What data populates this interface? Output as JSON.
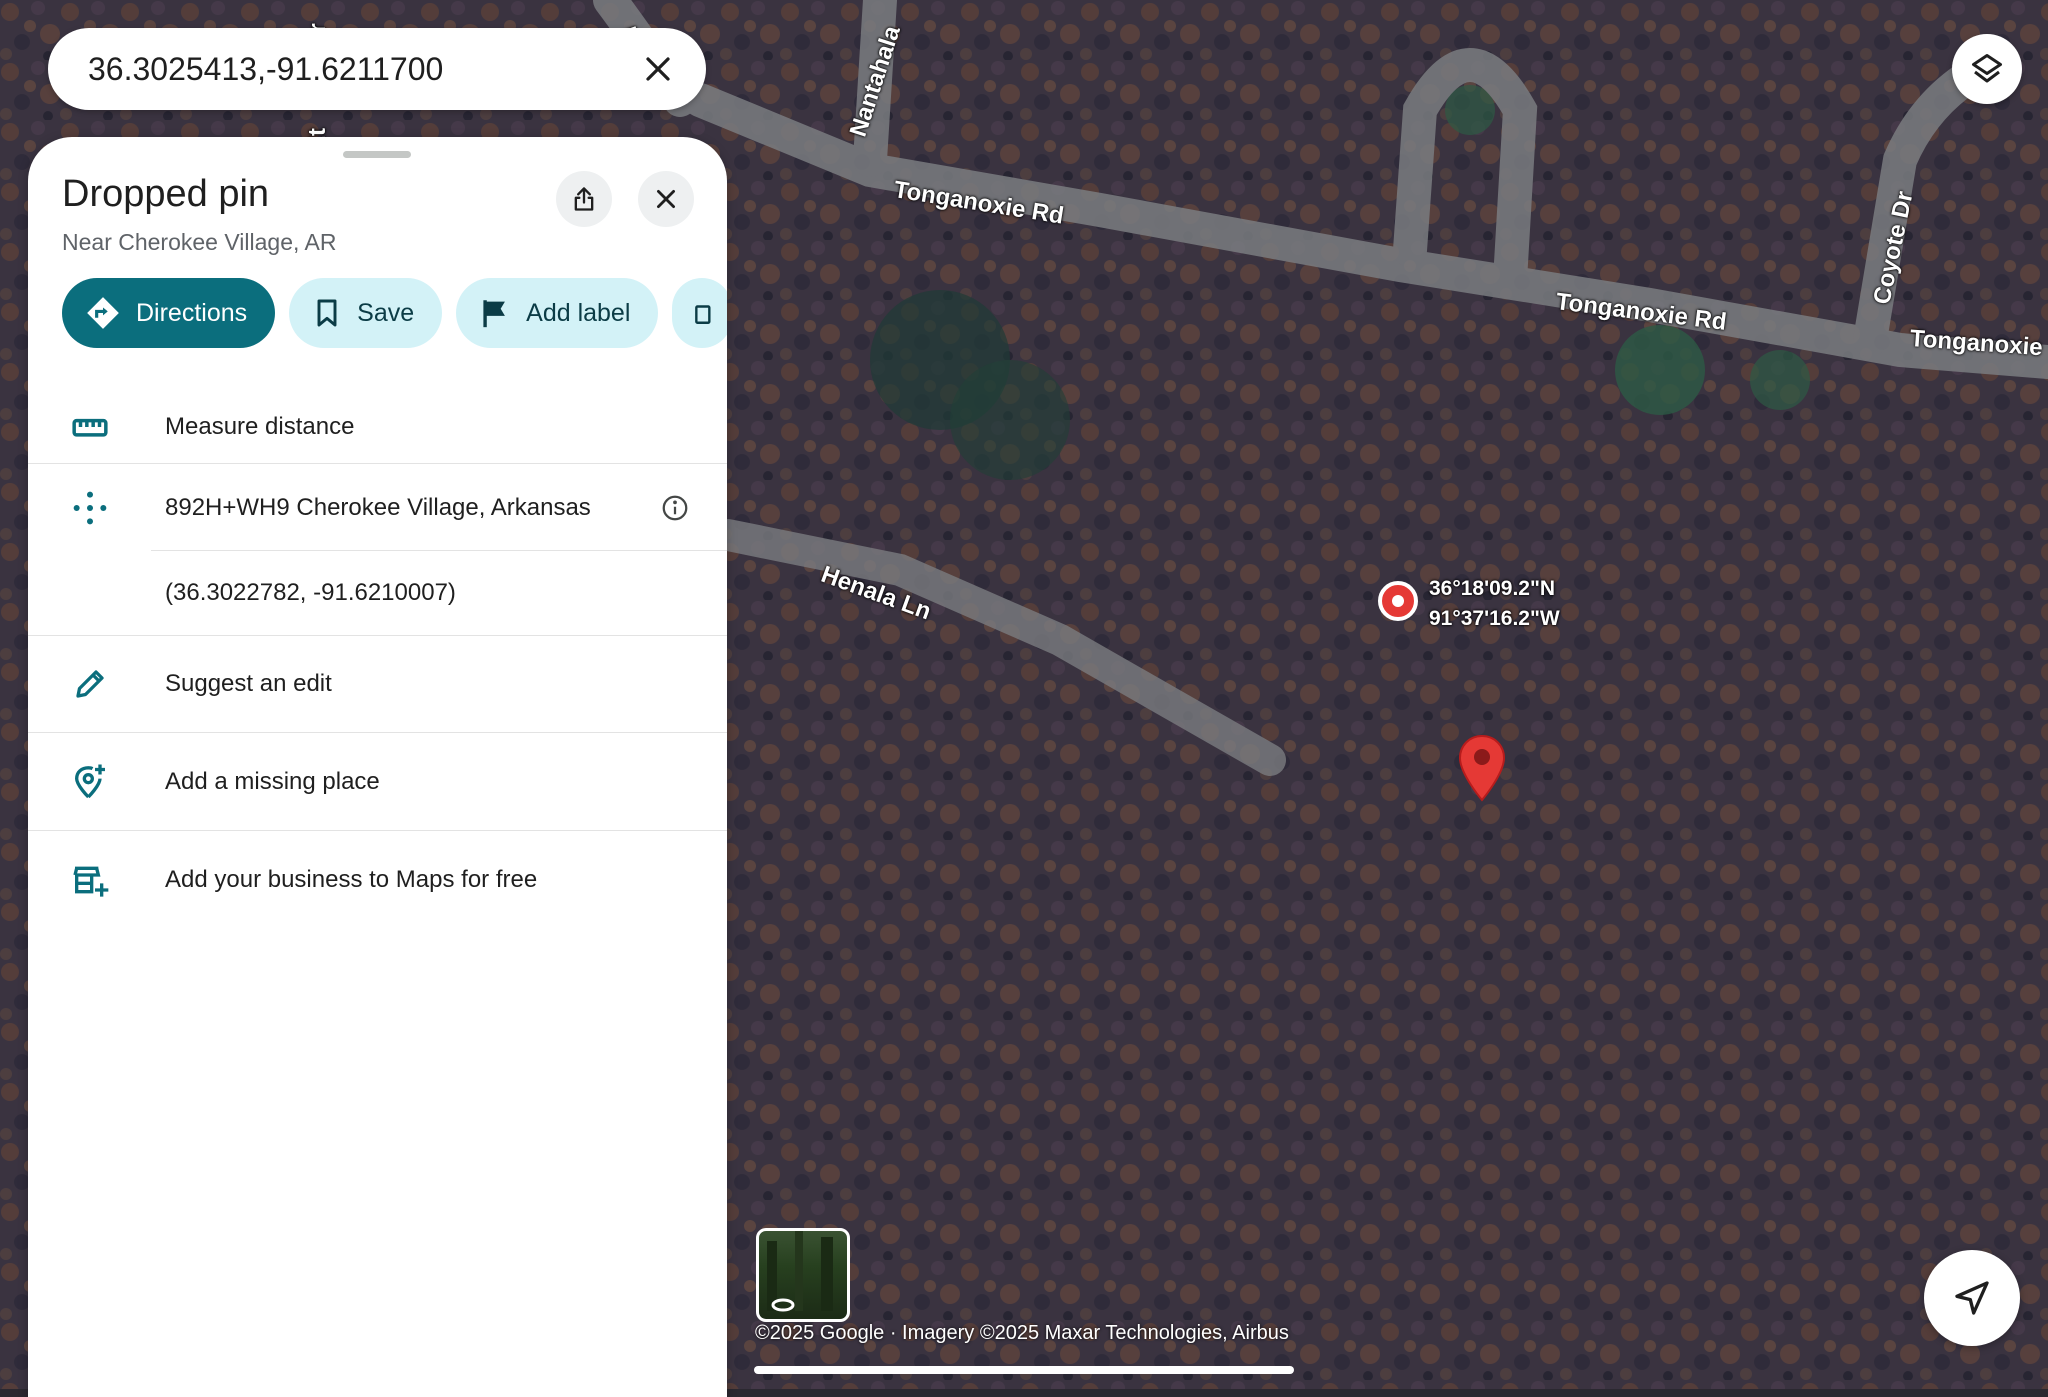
{
  "search": {
    "query": "36.3025413,-91.6211700"
  },
  "map": {
    "roads": [
      "Tonganoxie Rd",
      "Tonganoxie Rd",
      "Tonganoxie",
      "Henala Ln",
      "Coyote Dr",
      "Nantahala",
      "Rd",
      "Et",
      "Dr"
    ],
    "pin_coordinates": {
      "lat": "36°18'09.2\"N",
      "lng": "91°37'16.2\"W"
    },
    "attribution": "©2025 Google · Imagery ©2025 Maxar Technologies, Airbus",
    "pin_color": "#e53935"
  },
  "panel": {
    "title": "Dropped pin",
    "subtitle": "Near Cherokee Village, AR",
    "chips": [
      {
        "label": "Directions",
        "icon": "directions-icon"
      },
      {
        "label": "Save",
        "icon": "bookmark-icon"
      },
      {
        "label": "Add label",
        "icon": "flag-icon"
      }
    ],
    "rows": {
      "measure": "Measure distance",
      "plus_code": "892H+WH9 Cherokee Village, Arkansas",
      "coordinates": "(36.3022782, -91.6210007)",
      "suggest_edit": "Suggest an edit",
      "add_place": "Add a missing place",
      "add_business": "Add your business to Maps for free"
    },
    "accent_color": "#0b6e7d"
  }
}
